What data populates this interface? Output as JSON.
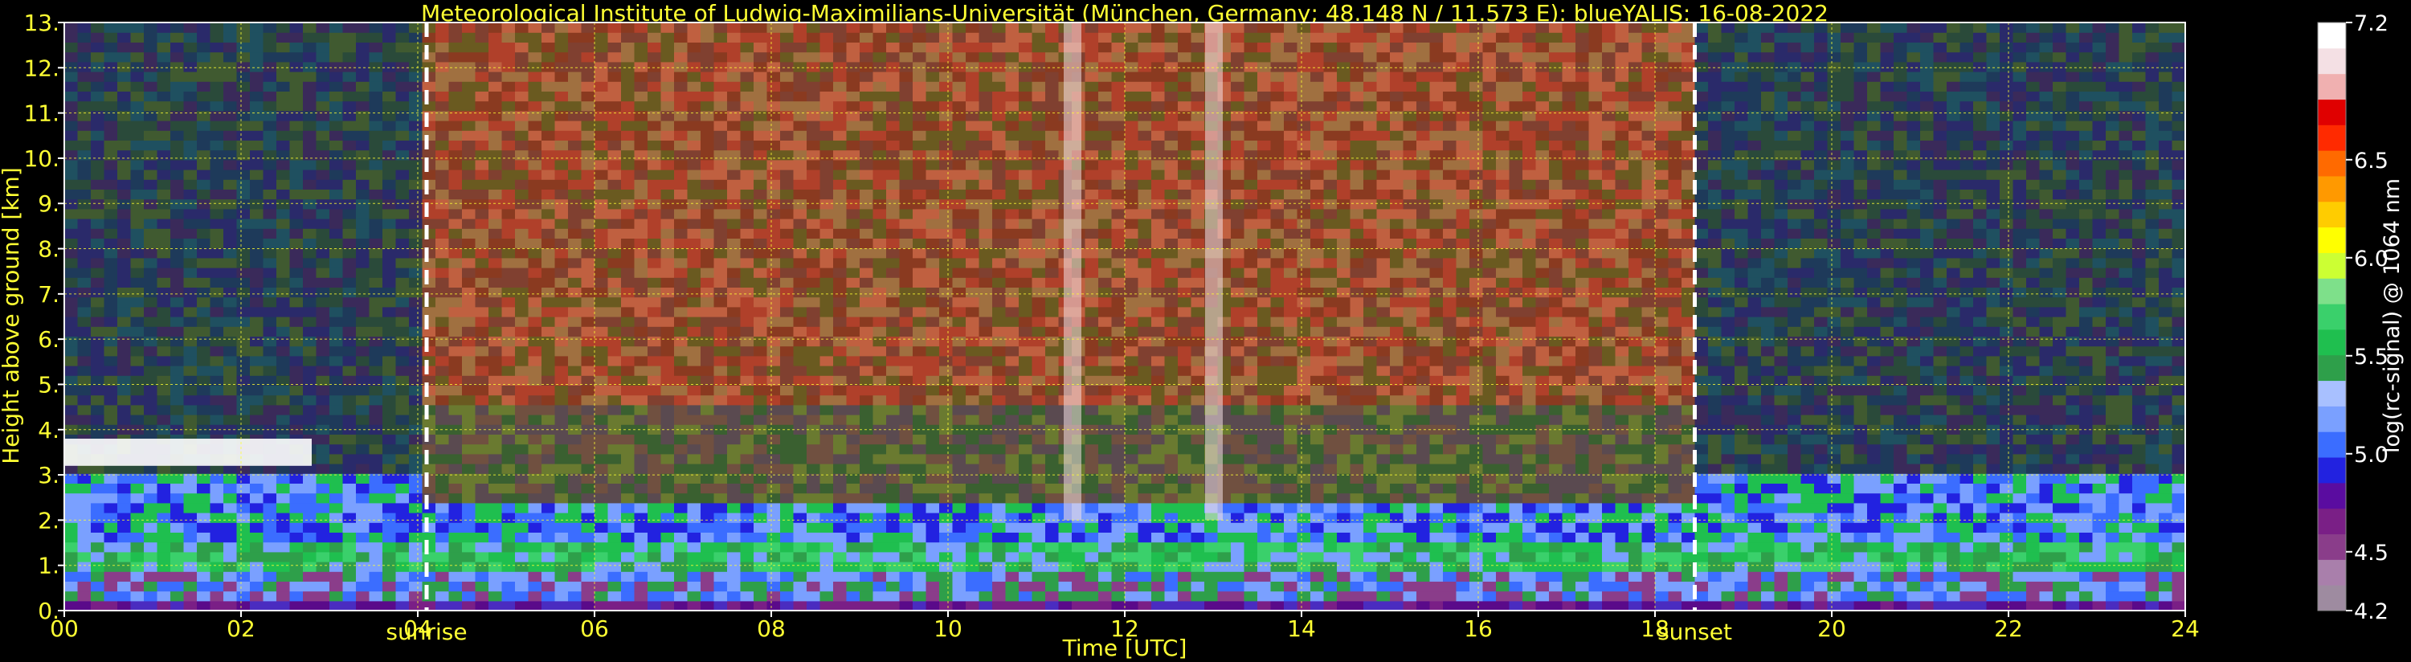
{
  "chart_data": {
    "type": "heatmap",
    "title": "Meteorological Institute of Ludwig-Maximilians-Universität (München, Germany; 48.148 N / 11.573 E):    blueYALIS: 16-08-2022",
    "xlabel": "Time [UTC]",
    "ylabel": "Height above ground [km]",
    "xlim": [
      0,
      24
    ],
    "ylim": [
      0,
      13
    ],
    "x_tick_labels": [
      "00",
      "02",
      "04",
      "06",
      "08",
      "10",
      "12",
      "14",
      "16",
      "18",
      "20",
      "22",
      "24"
    ],
    "y_tick_labels": [
      "0.",
      "1.",
      "2.",
      "3.",
      "4.",
      "5.",
      "6.",
      "7.",
      "8.",
      "9.",
      "10.",
      "11.",
      "12.",
      "13."
    ],
    "grid": true,
    "markers": [
      {
        "label": "sunrise",
        "x": 4.1
      },
      {
        "label": "sunset",
        "x": 18.45
      }
    ],
    "colorbar": {
      "label": "log(rc-signal) @ 1064 nm",
      "range": [
        4.2,
        7.2
      ],
      "tick_labels": [
        "4.2",
        "4.5",
        "5.0",
        "5.5",
        "6.0",
        "6.5",
        "7.2"
      ],
      "tick_values": [
        4.2,
        4.5,
        5.0,
        5.5,
        6.0,
        6.5,
        7.2
      ],
      "colors": [
        "#9e8ba0",
        "#a97fab",
        "#8a3d8a",
        "#7a1f86",
        "#5a0ca0",
        "#2222e0",
        "#3b6dff",
        "#7aa0ff",
        "#a8c0ff",
        "#2e9f4a",
        "#1fbf4f",
        "#3ad06b",
        "#7ee08a",
        "#ccff33",
        "#ffff00",
        "#ffcc00",
        "#ff9900",
        "#ff6a00",
        "#ff2a00",
        "#e00000",
        "#f0b0b0",
        "#f4e0e4",
        "#ffffff"
      ]
    },
    "features": {
      "cloud_layer_km": [
        3.2,
        3.8
      ],
      "cloud_time_utc": [
        0,
        2.8
      ],
      "boundary_layer_top_km": [
        2.0,
        3.0
      ],
      "virga_times_utc": [
        11.4,
        13.0
      ]
    }
  }
}
